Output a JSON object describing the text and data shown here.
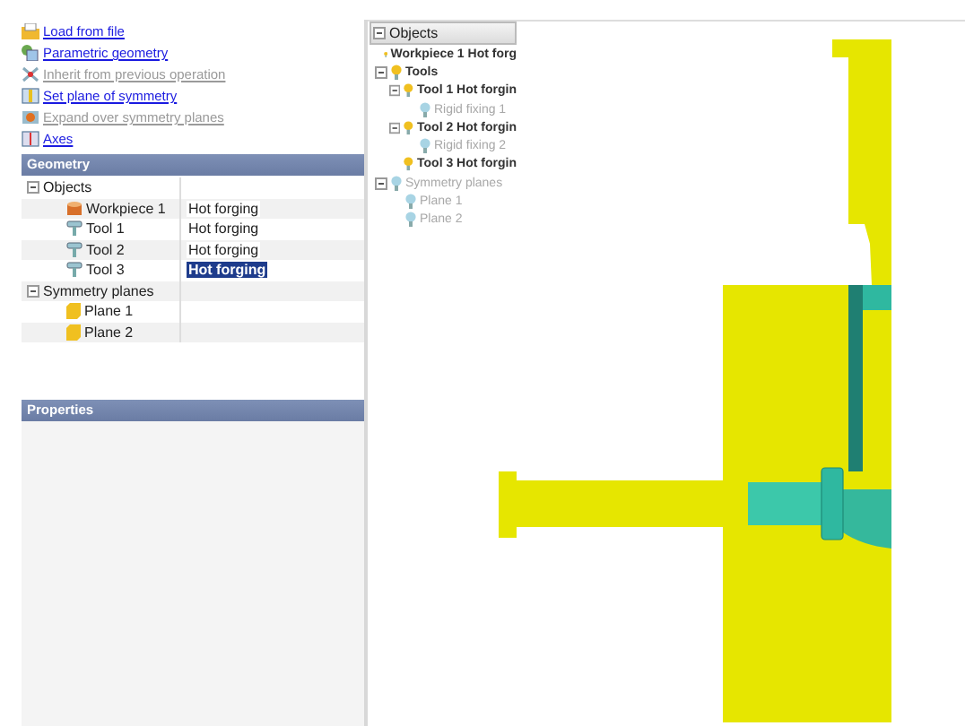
{
  "actions": [
    {
      "label": "Load from file",
      "kind": "folder",
      "disabled": false
    },
    {
      "label": "Parametric geometry",
      "kind": "shapes",
      "disabled": false
    },
    {
      "label": "Inherit from previous operation",
      "kind": "inherit",
      "disabled": true
    },
    {
      "label": "Set plane of symmetry",
      "kind": "plane",
      "disabled": false
    },
    {
      "label": "Expand over symmetry planes",
      "kind": "expand",
      "disabled": true
    },
    {
      "label": "Axes",
      "kind": "axes",
      "disabled": false
    }
  ],
  "geometry": {
    "title": "Geometry",
    "groups": [
      {
        "label": "Objects",
        "expanded": true,
        "children": [
          {
            "label": "Workpiece 1",
            "kind": "workpiece",
            "value": "Hot forging",
            "selected": false
          },
          {
            "label": "Tool 1",
            "kind": "tool",
            "value": "Hot forging",
            "selected": false
          },
          {
            "label": "Tool 2",
            "kind": "tool",
            "value": "Hot forging",
            "selected": false
          },
          {
            "label": "Tool 3",
            "kind": "tool",
            "value": "Hot forging",
            "selected": true
          }
        ]
      },
      {
        "label": "Symmetry planes",
        "expanded": true,
        "children": [
          {
            "label": "Plane 1",
            "kind": "plane"
          },
          {
            "label": "Plane 2",
            "kind": "plane"
          }
        ]
      }
    ]
  },
  "properties": {
    "title": "Properties"
  },
  "scene_tree": {
    "title": "Objects",
    "expanded": true,
    "items": [
      {
        "label": "Workpiece 1 Hot forg",
        "disabled": false
      },
      {
        "label": "Tools",
        "disabled": false,
        "expanded": true,
        "children": [
          {
            "label": "Tool 1 Hot forgin",
            "disabled": false,
            "expanded": true,
            "children": [
              {
                "label": "Rigid fixing 1",
                "disabled": true
              }
            ]
          },
          {
            "label": "Tool 2 Hot forgin",
            "disabled": false,
            "expanded": true,
            "children": [
              {
                "label": "Rigid fixing 2",
                "disabled": true
              }
            ]
          },
          {
            "label": "Tool 3 Hot forgin",
            "disabled": false
          }
        ]
      },
      {
        "label": "Symmetry planes",
        "disabled": true,
        "expanded": true,
        "children": [
          {
            "label": "Plane 1",
            "disabled": true
          },
          {
            "label": "Plane 2",
            "disabled": true
          }
        ]
      }
    ]
  }
}
